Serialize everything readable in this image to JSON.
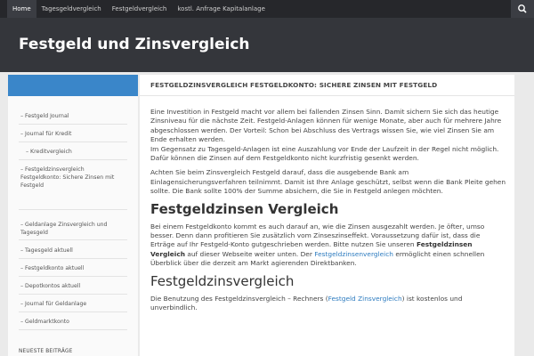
{
  "nav": {
    "items": [
      "Home",
      "Tagesgeldvergleich",
      "Festgeldvergleich",
      "kostl. Anfrage Kapitalanlage"
    ],
    "search_icon": "search-icon"
  },
  "header": {
    "site_title": "Festgeld und Zinsvergleich"
  },
  "sidebar": {
    "items": [
      "– Festgeld Journal",
      "– Journal für Kredit",
      "– Kreditvergleich",
      "– Festgeldzinsvergleich",
      "Festgeldkonto: Sichere Zinsen mit",
      "Festgeld",
      "– Geldanlage Zinsvergleich und",
      "Tagesgeld",
      "– Tagesgeld aktuell",
      "– Festgeldkonto aktuell",
      "– Depotkontos aktuell",
      "– Journal für Geldanlage",
      "– Geldmarktkonto"
    ],
    "section_label": "NEUESTE BEITRÄGE"
  },
  "main": {
    "page_heading": "FESTGELDZINSVERGLEICH FESTGELDKONTO: SICHERE ZINSEN MIT FESTGELD",
    "p1": "Eine Investition in Festgeld macht vor allem bei fallenden Zinsen Sinn. Damit sichern Sie sich das heutige Zinsniveau für die nächste Zeit. Festgeld-Anlagen können für wenige Monate, aber auch für mehrere Jahre abgeschlossen werden. Der Vorteil: Schon bei Abschluss des Vertrags wissen Sie, wie viel Zinsen Sie am Ende erhalten werden.",
    "p1b": "Im Gegensatz zu Tagesgeld-Anlagen ist eine Auszahlung vor Ende der Laufzeit in der Regel nicht möglich. Dafür können die Zinsen auf dem Festgeldkonto nicht kurzfristig gesenkt werden.",
    "p2": "Achten Sie beim Zinsvergleich Festgeld darauf, dass die ausgebende Bank am Einlagensicherungsverfahren teilnimmt. Damit ist Ihre Anlage geschützt, selbst wenn die Bank Pleite gehen sollte. Die Bank sollte 100% der Summe absichern, die Sie in Festgeld anlegen möchten.",
    "h2": "Festgeldzinsen Vergleich",
    "p3_a": "Bei einem Festgeldkonto kommt es auch darauf an, wie die Zinsen ausgezahlt werden. Je öfter, umso besser. Denn dann profitieren Sie zusätzlich vom Zinseszinseffekt. Voraussetzung dafür ist, dass die Erträge auf Ihr Festgeld-Konto gutgeschrieben werden. Bitte nutzen Sie unseren ",
    "p3_bold": "Festgeldzinsen Vergleich",
    "p3_b": " auf dieser Webseite weiter unten. Der ",
    "p3_link": "Festgeldzinsenvergleich",
    "p3_c": " ermöglicht einen schnellen Überblick über die derzeit am Markt agierenden Direktbanken.",
    "h3": "Festgeldzinsvergleich",
    "p4_a": "Die Benutzung des Festgeldzinsvergleich – Rechners (",
    "p4_link": "Festgeld Zinsvergleich",
    "p4_b": ") ist kostenlos und unverbindlich."
  },
  "colors": {
    "topbar": "#26272b",
    "header": "#34363b",
    "accent": "#3a86c9",
    "link": "#2c7bbf"
  }
}
